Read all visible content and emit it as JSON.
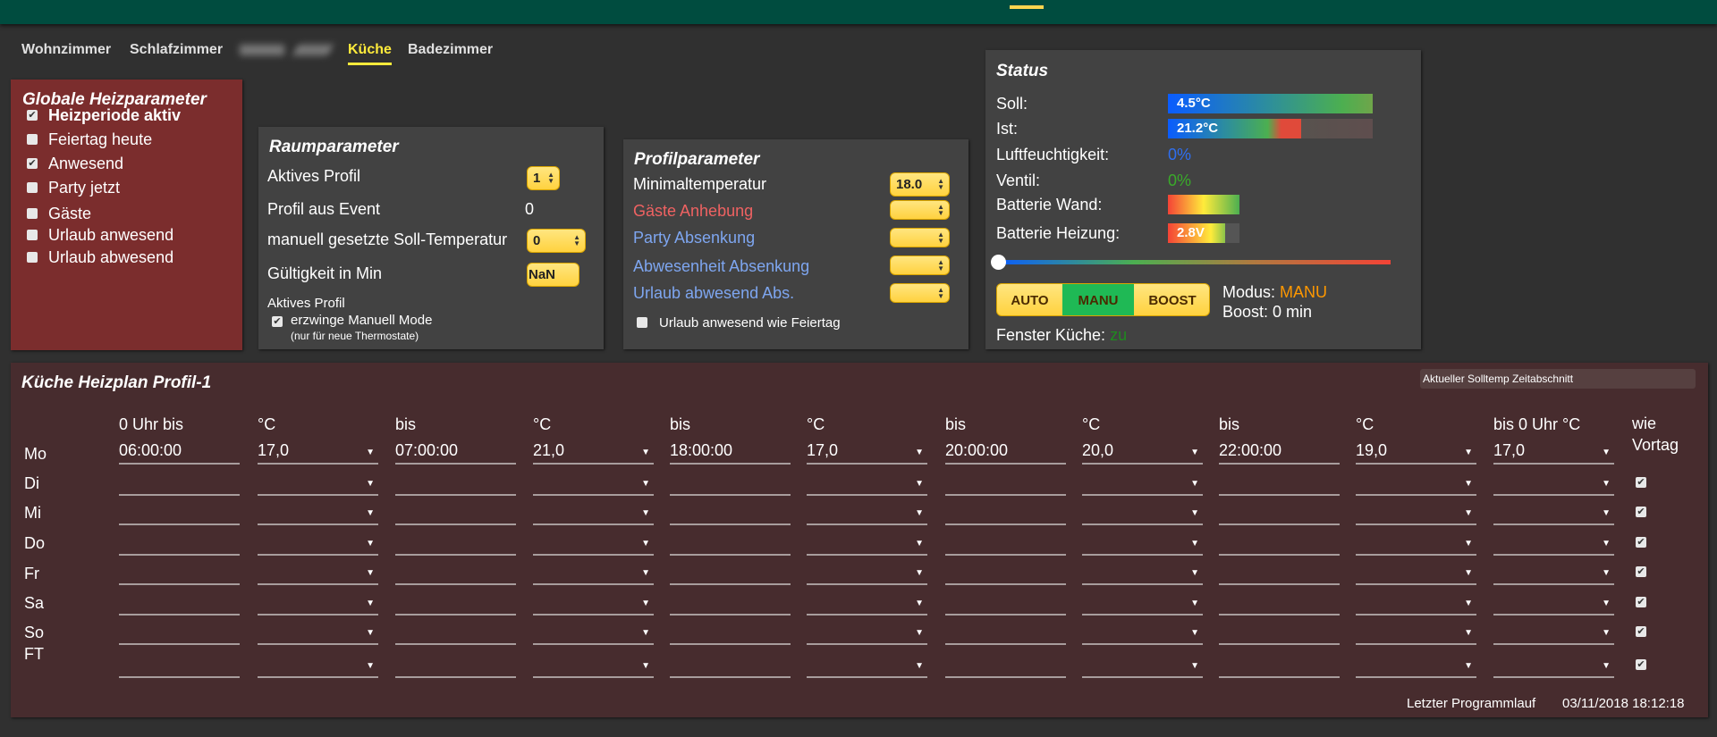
{
  "tabs": [
    {
      "label": "Wohnzimmer"
    },
    {
      "label": "Schlafzimmer"
    },
    {
      "label": "Küche",
      "active": true
    },
    {
      "label": "Badezimmer"
    }
  ],
  "global": {
    "title": "Globale Heizparameter",
    "items": [
      {
        "label": "Heizperiode aktiv",
        "checked": true
      },
      {
        "label": "Feiertag heute",
        "checked": false
      },
      {
        "label": "Anwesend",
        "checked": true
      },
      {
        "label": "Party jetzt",
        "checked": false
      },
      {
        "label": "Gäste",
        "checked": false
      },
      {
        "label": "Urlaub anwesend",
        "checked": false
      },
      {
        "label": "Urlaub abwesend",
        "checked": false
      }
    ]
  },
  "room": {
    "title": "Raumparameter",
    "active_profile_label": "Aktives Profil",
    "active_profile_value": "1",
    "event_label": "Profil aus Event",
    "event_value": "0",
    "manual_label": "manuell gesetzte Soll-Temperatur",
    "manual_value": "0",
    "validity_label": "Gültigkeit in Min",
    "validity_value": "NaN",
    "sub_label": "Aktives Profil",
    "force_label": "erzwinge Manuell Mode",
    "force_note": "(nur für neue Thermostate)",
    "force_checked": true
  },
  "profile": {
    "title": "Profilparameter",
    "min_label": "Minimaltemperatur",
    "min_value": "18.0",
    "guest_label": "Gäste Anhebung",
    "party_label": "Party Absenkung",
    "absent_label": "Abwesenheit Absenkung",
    "vacation_label": "Urlaub abwesend Abs.",
    "holiday_label": "Urlaub anwesend wie Feiertag"
  },
  "status": {
    "title": "Status",
    "soll_label": "Soll:",
    "soll_value": "4.5°C",
    "ist_label": "Ist:",
    "ist_value": "21.2°C",
    "ist_fill_pct": 65,
    "humidity_label": "Luftfeuchtigkeit:",
    "humidity_value": "0%",
    "valve_label": "Ventil:",
    "valve_value": "0%",
    "bat_wall_label": "Batterie Wand:",
    "bat_heat_label": "Batterie Heizung:",
    "bat_heat_value": "2.8V",
    "slider_pct": 0,
    "btn_auto": "AUTO",
    "btn_manu": "MANU",
    "btn_boost": "BOOST",
    "mode_label": "Modus:",
    "mode_value": "MANU",
    "boost_text": "Boost: 0 min",
    "window_label": "Fenster Küche:",
    "window_value": "zu"
  },
  "plan": {
    "title": "Küche Heizplan Profil-1",
    "current_label": "Aktueller Solltemp Zeitabschnitt",
    "headers": [
      "0 Uhr bis",
      "°C",
      "bis",
      "°C",
      "bis",
      "°C",
      "bis",
      "°C",
      "bis",
      "°C",
      "bis 0 Uhr °C"
    ],
    "same_label_1": "wie",
    "same_label_2": "Vortag",
    "rows": [
      {
        "day": "Mo",
        "values": [
          "06:00:00",
          "17,0",
          "07:00:00",
          "21,0",
          "18:00:00",
          "17,0",
          "20:00:00",
          "20,0",
          "22:00:00",
          "19,0",
          "17,0"
        ],
        "same": null
      },
      {
        "day": "Di",
        "values": [
          "",
          "",
          "",
          "",
          "",
          "",
          "",
          "",
          "",
          "",
          ""
        ],
        "same": true
      },
      {
        "day": "Mi",
        "values": [
          "",
          "",
          "",
          "",
          "",
          "",
          "",
          "",
          "",
          "",
          ""
        ],
        "same": true
      },
      {
        "day": "Do",
        "values": [
          "",
          "",
          "",
          "",
          "",
          "",
          "",
          "",
          "",
          "",
          ""
        ],
        "same": true
      },
      {
        "day": "Fr",
        "values": [
          "",
          "",
          "",
          "",
          "",
          "",
          "",
          "",
          "",
          "",
          ""
        ],
        "same": true
      },
      {
        "day": "Sa",
        "values": [
          "",
          "",
          "",
          "",
          "",
          "",
          "",
          "",
          "",
          "",
          ""
        ],
        "same": true
      },
      {
        "day": "So",
        "values": [
          "",
          "",
          "",
          "",
          "",
          "",
          "",
          "",
          "",
          "",
          ""
        ],
        "same": true
      },
      {
        "day": "FT",
        "values": [
          "",
          "",
          "",
          "",
          "",
          "",
          "",
          "",
          "",
          "",
          ""
        ],
        "same": true
      }
    ],
    "last_run_label": "Letzter Programmlauf",
    "last_run_value": "03/11/2018 18:12:18"
  },
  "colors": {
    "accent": "#ffeb3b",
    "green_bar": "#004c3f",
    "global_panel": "#7b2d2d",
    "plan_panel": "#472c2e",
    "guest": "#ef6262",
    "blue_label": "#7ea6f0",
    "mode": "#ff9800",
    "window_ok": "#1f8a1f"
  }
}
